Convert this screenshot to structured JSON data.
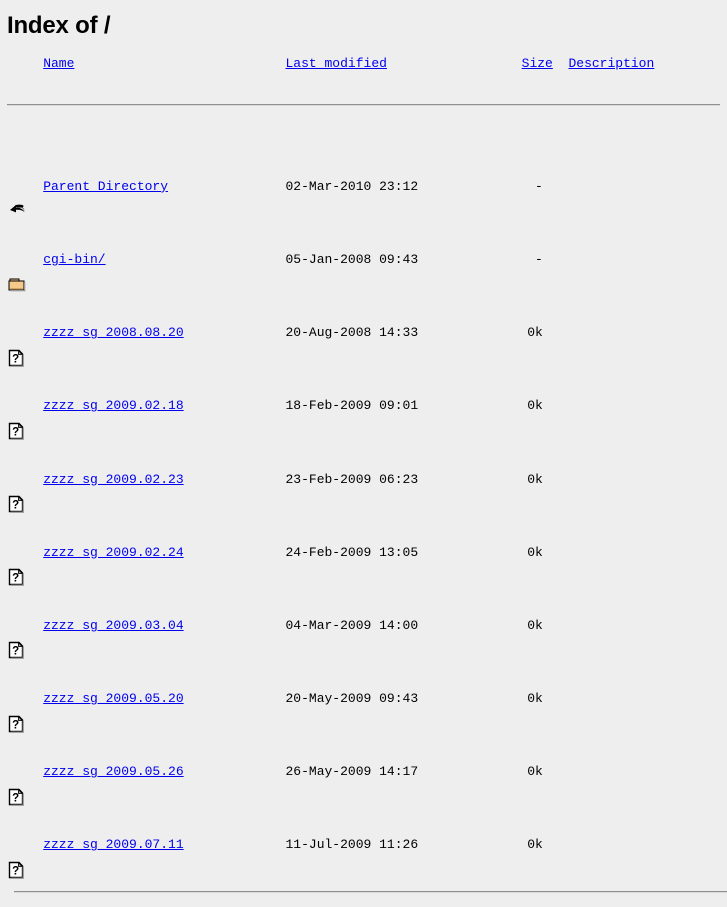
{
  "page": {
    "title": "Index of /",
    "background_color": "#eeeeee",
    "link_color": "#0000ee",
    "text_color": "#000000",
    "rule_color": "#9a9a9a"
  },
  "table": {
    "headers": {
      "name": "Name",
      "last_modified": "Last modified",
      "size": "Size",
      "description": "Description"
    },
    "rows": [
      {
        "icon": "back-arrow-icon",
        "name": "Parent Directory",
        "last_modified": "02-Mar-2010 23:12",
        "size": "-",
        "description": ""
      },
      {
        "icon": "folder-icon",
        "name": "cgi-bin/",
        "last_modified": "05-Jan-2008 09:43",
        "size": "-",
        "description": ""
      },
      {
        "icon": "unknown-file-icon",
        "name": "zzzz sg 2008.08.20",
        "last_modified": "20-Aug-2008 14:33",
        "size": "0k",
        "description": ""
      },
      {
        "icon": "unknown-file-icon",
        "name": "zzzz sg 2009.02.18",
        "last_modified": "18-Feb-2009 09:01",
        "size": "0k",
        "description": ""
      },
      {
        "icon": "unknown-file-icon",
        "name": "zzzz sg 2009.02.23",
        "last_modified": "23-Feb-2009 06:23",
        "size": "0k",
        "description": ""
      },
      {
        "icon": "unknown-file-icon",
        "name": "zzzz sg 2009.02.24",
        "last_modified": "24-Feb-2009 13:05",
        "size": "0k",
        "description": ""
      },
      {
        "icon": "unknown-file-icon",
        "name": "zzzz sg 2009.03.04",
        "last_modified": "04-Mar-2009 14:00",
        "size": "0k",
        "description": ""
      },
      {
        "icon": "unknown-file-icon",
        "name": "zzzz sg 2009.05.20",
        "last_modified": "20-May-2009 09:43",
        "size": "0k",
        "description": ""
      },
      {
        "icon": "unknown-file-icon",
        "name": "zzzz sg 2009.05.26",
        "last_modified": "26-May-2009 14:17",
        "size": "0k",
        "description": ""
      },
      {
        "icon": "unknown-file-icon",
        "name": "zzzz sg 2009.07.11",
        "last_modified": "11-Jul-2009 11:26",
        "size": "0k",
        "description": ""
      }
    ]
  }
}
